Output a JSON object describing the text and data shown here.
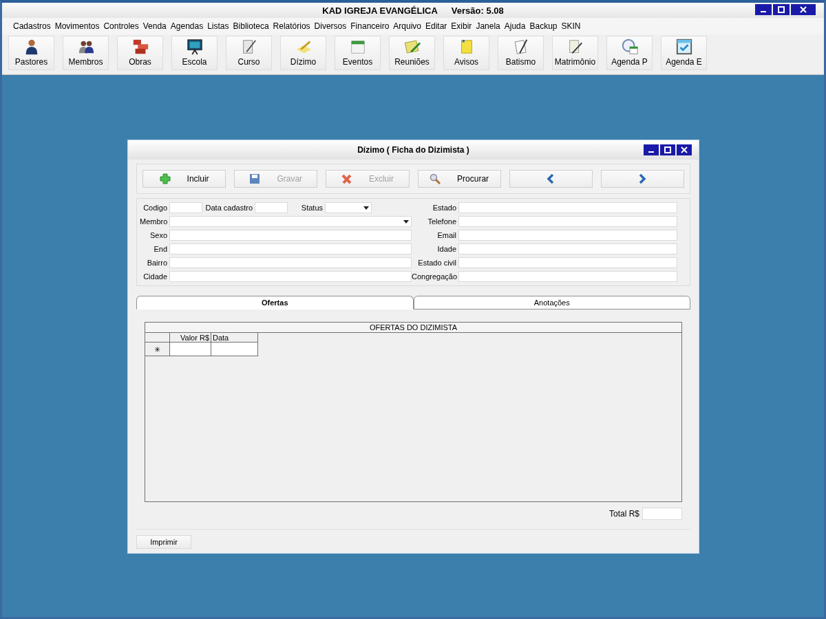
{
  "window": {
    "title": "KAD IGREJA EVANGÉLICA",
    "version": "Versão: 5.08"
  },
  "menu": [
    "Cadastros",
    "Movimentos",
    "Controles",
    "Venda",
    "Agendas",
    "Listas",
    "Biblioteca",
    "Relatórios",
    "Diversos",
    "Financeiro",
    "Arquivo",
    "Editar",
    "Exibir",
    "Janela",
    "Ajuda",
    "Backup",
    "SKIN"
  ],
  "toolbar": [
    "Pastores",
    "Membros",
    "Obras",
    "Escola",
    "Curso",
    "Dízimo",
    "Eventos",
    "Reuniões",
    "Avisos",
    "Batismo",
    "Matrimônio",
    "Agenda P",
    "Agenda E"
  ],
  "dialog": {
    "title": "Dízimo ( Ficha do Dizimista )",
    "actions": [
      {
        "kind": "add",
        "label": "Incluir",
        "disabled": false
      },
      {
        "kind": "save",
        "label": "Gravar",
        "disabled": true
      },
      {
        "kind": "delete",
        "label": "Excluir",
        "disabled": true
      },
      {
        "kind": "search",
        "label": "Procurar",
        "disabled": false
      },
      {
        "kind": "prev",
        "disabled": false
      },
      {
        "kind": "next",
        "disabled": false
      }
    ],
    "top_row": [
      {
        "label": "Codigo",
        "kind": "text"
      },
      {
        "label": "Data cadastro",
        "kind": "text"
      },
      {
        "label": "Status",
        "kind": "combo"
      }
    ],
    "left_fields": [
      {
        "label": "Membro",
        "kind": "combo"
      },
      {
        "label": "Sexo",
        "kind": "text"
      },
      {
        "label": "End",
        "kind": "text"
      },
      {
        "label": "Bairro",
        "kind": "text"
      },
      {
        "label": "Cidade",
        "kind": "text"
      }
    ],
    "right_fields": [
      "Estado",
      "Telefone",
      "Email",
      "Idade",
      "Estado civil",
      "Congregação"
    ],
    "tabs": [
      {
        "label": "Ofertas",
        "selected": true
      },
      {
        "label": "Anotações",
        "selected": false
      }
    ],
    "grid": {
      "caption": "OFERTAS DO DIZIMISTA",
      "columns": [
        "Valor R$",
        "Data"
      ],
      "new_row_marker": "✳"
    },
    "total_label": "Total R$",
    "print_button": "Imprimir"
  }
}
